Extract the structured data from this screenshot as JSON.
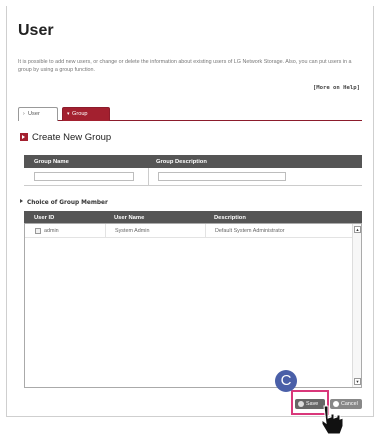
{
  "page": {
    "title": "User",
    "description": "It is possible to add new users, or change or delete the information about existing users of LG Network Storage. Also, you can put users in a group by using a group function.",
    "help_link": "[More on Help]"
  },
  "tabs": [
    {
      "label": "User",
      "active": false
    },
    {
      "label": "Group",
      "active": true
    }
  ],
  "create_group": {
    "title": "Create New Group",
    "columns": [
      "Group Name",
      "Group Description"
    ],
    "group_name_value": "",
    "group_description_value": ""
  },
  "members": {
    "title": "Choice of Group Member",
    "columns": [
      "User ID",
      "User Name",
      "Description"
    ],
    "rows": [
      {
        "user_id": "admin",
        "user_name": "System Admin",
        "description": "Default System Administrator",
        "checked": false
      }
    ]
  },
  "buttons": {
    "save": "Save",
    "cancel": "Cancel"
  },
  "annotation": {
    "marker_label": "C"
  },
  "colors": {
    "accent": "#a3202f",
    "header_bg": "#555555",
    "highlight": "#d9377a",
    "marker": "#4a5fa8"
  }
}
